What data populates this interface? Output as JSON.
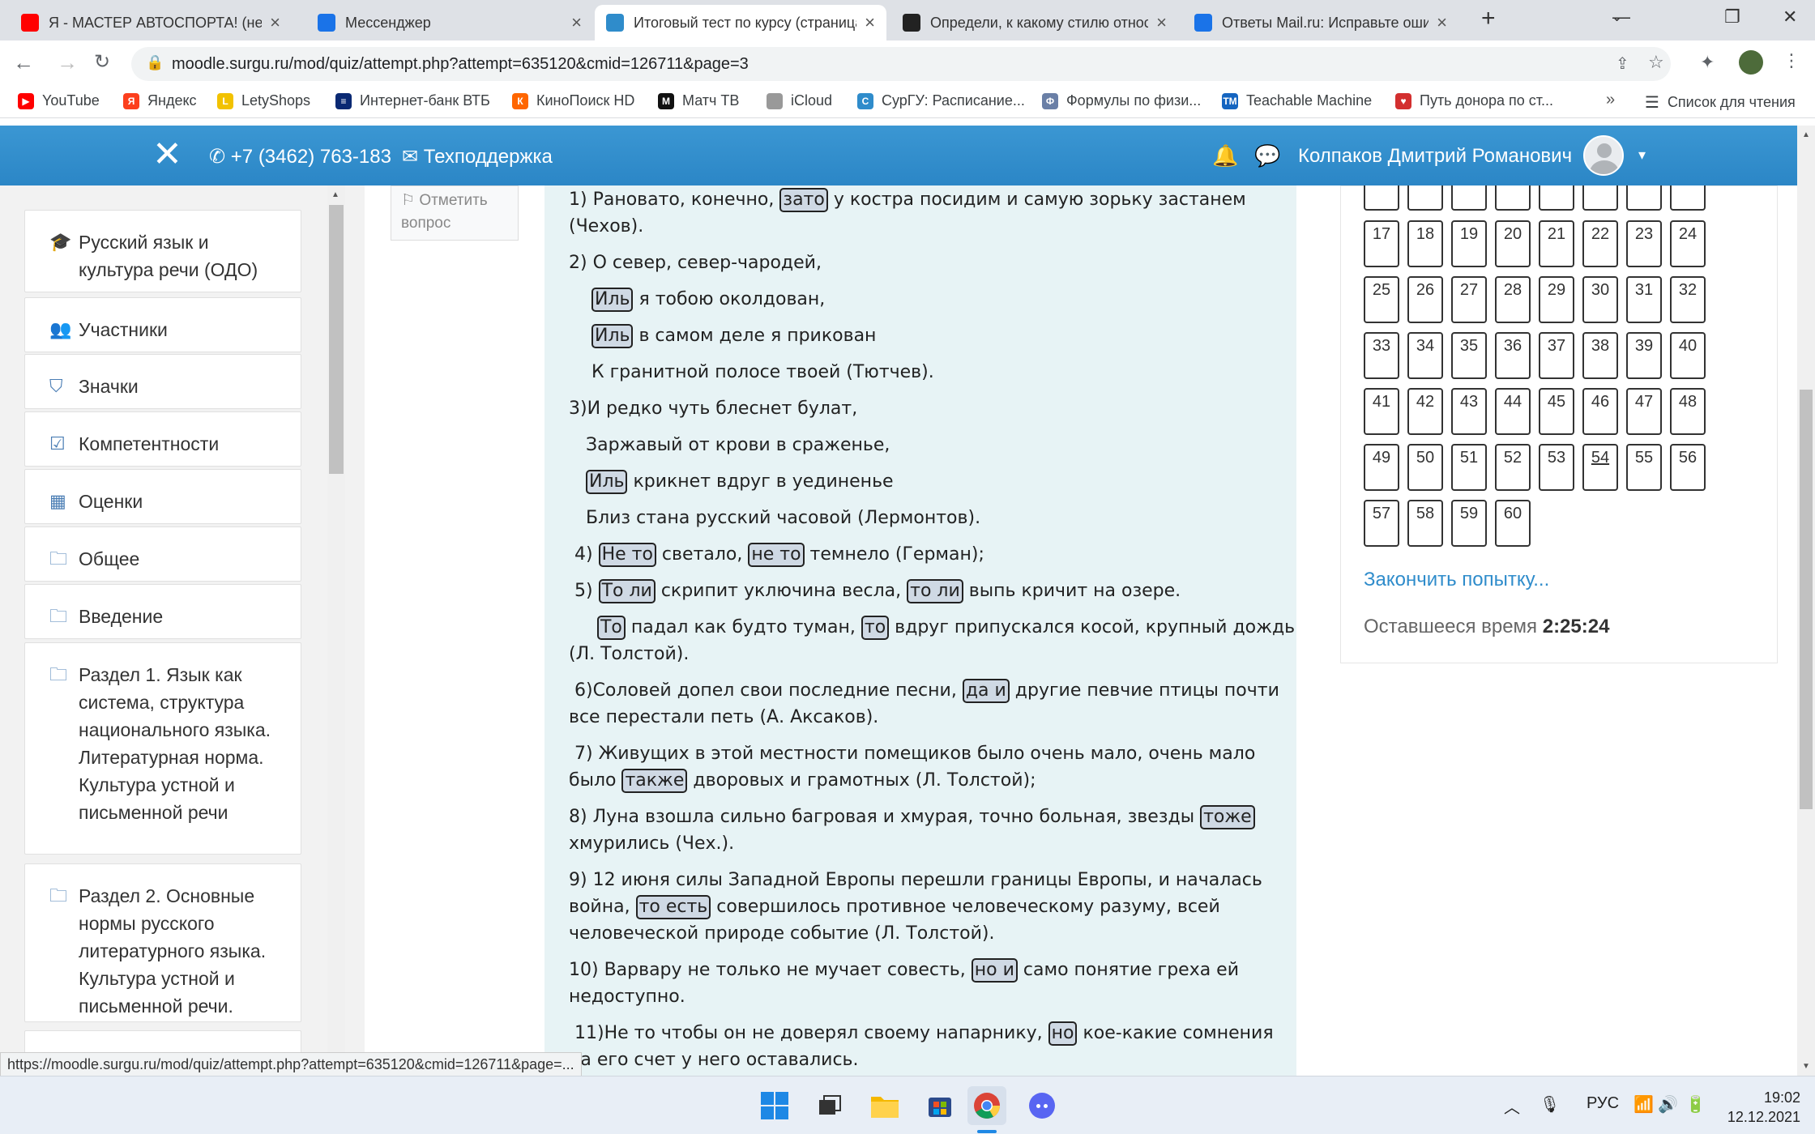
{
  "browser": {
    "tabs": [
      {
        "title": "Я - МАСТЕР АВТОСПОРТА! (нетипичный",
        "favicon": "youtube-icon",
        "color": "#ff0000"
      },
      {
        "title": "Мессенджер",
        "favicon": "messenger-icon",
        "color": "#1a73e8"
      },
      {
        "title": "Итоговый тест по курсу (страница",
        "favicon": "moodle-icon",
        "color": "#2f8ccb"
      },
      {
        "title": "Определи, к какому стилю относится",
        "favicon": "znanija-icon",
        "color": "#222222"
      },
      {
        "title": "Ответы Mail.ru: Исправьте ошибки",
        "favicon": "mailru-icon",
        "color": "#1a73e8"
      }
    ],
    "new_tab": "+",
    "url": "moodle.surgu.ru/mod/quiz/attempt.php?attempt=635120&cmid=126711&page=3",
    "status_url": "https://moodle.surgu.ru/mod/quiz/attempt.php?attempt=635120&cmid=126711&page=...",
    "bookmarks": [
      {
        "label": "YouTube",
        "color": "#ff0000",
        "glyph": "▶"
      },
      {
        "label": "Яндекс",
        "color": "#fc3f1d",
        "glyph": "Я"
      },
      {
        "label": "LetyShops",
        "color": "#f2c200",
        "glyph": "L"
      },
      {
        "label": "Интернет-банк ВТБ",
        "color": "#0a2973",
        "glyph": "≡"
      },
      {
        "label": "КиноПоиск HD",
        "color": "#ff6600",
        "glyph": "К"
      },
      {
        "label": "Матч ТВ",
        "color": "#111111",
        "glyph": "M"
      },
      {
        "label": "iCloud",
        "color": "#999999",
        "glyph": ""
      },
      {
        "label": "СурГУ: Расписание...",
        "color": "#2f8ccb",
        "glyph": "С"
      },
      {
        "label": "Формулы по физи...",
        "color": "#6a7fa6",
        "glyph": "Ф"
      },
      {
        "label": "Teachable Machine",
        "color": "#1565c0",
        "glyph": "TM"
      },
      {
        "label": "Путь донора по ст...",
        "color": "#d32f2f",
        "glyph": "♥"
      }
    ],
    "more": "»",
    "reading_list": "Список для чтения"
  },
  "navbar": {
    "phone": "+7 (3462) 763-183",
    "support": "Техподдержка",
    "user_name": "Колпаков Дмитрий Романович"
  },
  "drawer": [
    {
      "label": "Русский язык и культура речи (ОДО)",
      "icon": "graduation-cap-icon",
      "glyph": "🎓"
    },
    {
      "label": "Участники",
      "icon": "users-icon",
      "glyph": "👥"
    },
    {
      "label": "Значки",
      "icon": "shield-icon",
      "glyph": "⛉"
    },
    {
      "label": "Компетентности",
      "icon": "checkbox-icon",
      "glyph": "☑"
    },
    {
      "label": "Оценки",
      "icon": "table-icon",
      "glyph": "▦"
    },
    {
      "label": "Общее",
      "icon": "folder-icon",
      "glyph": "🗀"
    },
    {
      "label": "Введение",
      "icon": "folder-icon",
      "glyph": "🗀"
    },
    {
      "label": "Раздел 1. Язык как система, структура национального языка. Литературная норма. Культура устной и письменной речи",
      "icon": "folder-icon",
      "glyph": "🗀"
    },
    {
      "label": "Раздел 2. Основные нормы русского литературного языка. Культура устной и письменной речи.",
      "icon": "folder-icon",
      "glyph": "🗀"
    }
  ],
  "flag_question": "Отметить вопрос",
  "question_lines": [
    [
      {
        "t": "1) Рановато, конечно, "
      },
      {
        "t": "зато",
        "h": true
      },
      {
        "t": " у костра посидим и самую зорьку застанем"
      }
    ],
    [
      {
        "t": "(Чехов)."
      }
    ],
    [
      {
        "t": "2) О север, север-чародей,"
      }
    ],
    [
      {
        "t": "    "
      },
      {
        "t": "Иль",
        "h": true
      },
      {
        "t": " я тобою околдован,"
      }
    ],
    [
      {
        "t": "    "
      },
      {
        "t": "Иль",
        "h": true
      },
      {
        "t": " в самом деле я прикован"
      }
    ],
    [
      {
        "t": "    К гранитной полосе твоей (Тютчев)."
      }
    ],
    [
      {
        "t": "3)И редко чуть блеснет булат,"
      }
    ],
    [
      {
        "t": "   Заржавый от крови в сраженье,"
      }
    ],
    [
      {
        "t": "   "
      },
      {
        "t": "Иль",
        "h": true
      },
      {
        "t": " крикнет вдруг в уединенье"
      }
    ],
    [
      {
        "t": "   Близ стана русский часовой (Лермонтов)."
      }
    ],
    [
      {
        "t": " 4) "
      },
      {
        "t": "Не то",
        "h": true
      },
      {
        "t": " светало, "
      },
      {
        "t": "не то",
        "h": true
      },
      {
        "t": " темнело (Герман);"
      }
    ],
    [
      {
        "t": " 5) "
      },
      {
        "t": "То ли",
        "h": true
      },
      {
        "t": " скрипит уключина весла, "
      },
      {
        "t": "то ли",
        "h": true
      },
      {
        "t": " выпь кричит на озере."
      }
    ],
    [
      {
        "t": "     "
      },
      {
        "t": "То",
        "h": true
      },
      {
        "t": " падал как будто туман, "
      },
      {
        "t": "то",
        "h": true
      },
      {
        "t": " вдруг припускался косой, крупный дождь"
      }
    ],
    [
      {
        "t": "(Л. Толстой)."
      }
    ],
    [
      {
        "t": " 6)Соловей допел свои последние песни, "
      },
      {
        "t": "да и",
        "h": true
      },
      {
        "t": " другие певчие птицы почти"
      }
    ],
    [
      {
        "t": "все перестали петь (А. Аксаков)."
      }
    ],
    [
      {
        "t": " 7) Живущих в этой местности помещиков было очень мало, очень мало"
      }
    ],
    [
      {
        "t": "было "
      },
      {
        "t": "также",
        "h": true
      },
      {
        "t": " дворовых и грамотных (Л. Толстой);"
      }
    ],
    [
      {
        "t": "8) Луна взошла сильно багровая и хмурая, точно больная, звезды "
      },
      {
        "t": "тоже",
        "h": true
      }
    ],
    [
      {
        "t": "хмурились (Чех.)."
      }
    ],
    [
      {
        "t": "9) 12 июня силы Западной Европы перешли границы Европы, и началась"
      }
    ],
    [
      {
        "t": "война, "
      },
      {
        "t": "то есть",
        "h": true
      },
      {
        "t": " совершилось противное человеческому разуму, всей"
      }
    ],
    [
      {
        "t": "человеческой природе событие (Л. Толстой)."
      }
    ],
    [
      {
        "t": "10) Варвару не только не мучает совесть, "
      },
      {
        "t": "но и",
        "h": true
      },
      {
        "t": " само понятие греха ей"
      }
    ],
    [
      {
        "t": "недоступно."
      }
    ],
    [
      {
        "t": " 11)Не то чтобы он не доверял своему напарнику, "
      },
      {
        "t": "но",
        "h": true
      },
      {
        "t": " кое-какие сомнения"
      }
    ],
    [
      {
        "t": "на его счет у него оставались."
      }
    ]
  ],
  "quiz_nav": {
    "numbers": [
      17,
      18,
      19,
      20,
      21,
      22,
      23,
      24,
      25,
      26,
      27,
      28,
      29,
      30,
      31,
      32,
      33,
      34,
      35,
      36,
      37,
      38,
      39,
      40,
      41,
      42,
      43,
      44,
      45,
      46,
      47,
      48,
      49,
      50,
      51,
      52,
      53,
      54,
      55,
      56,
      57,
      58,
      59,
      60
    ],
    "current": 54,
    "finish_label": "Закончить попытку...",
    "time_label": "Оставшееся время",
    "time_value": "2:25:24"
  },
  "taskbar": {
    "lang": "РУС",
    "time": "19:02",
    "date": "12.12.2021"
  }
}
